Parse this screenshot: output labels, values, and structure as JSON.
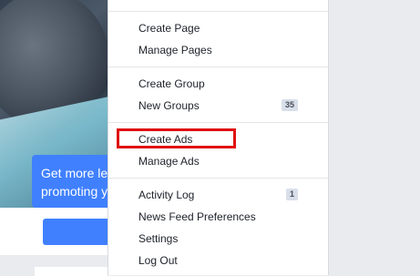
{
  "background": {
    "promo_text_line1": "Get more le",
    "promo_text_line2": "promoting y"
  },
  "menu": {
    "items": [
      {
        "label": "Create Page"
      },
      {
        "label": "Manage Pages"
      },
      {
        "label": "Create Group"
      },
      {
        "label": "New Groups",
        "badge": "35"
      },
      {
        "label": "Create Ads"
      },
      {
        "label": "Manage Ads"
      },
      {
        "label": "Activity Log",
        "badge": "1"
      },
      {
        "label": "News Feed Preferences"
      },
      {
        "label": "Settings"
      },
      {
        "label": "Log Out"
      }
    ]
  },
  "colors": {
    "accent": "#4080ff",
    "highlight": "#e01010"
  }
}
